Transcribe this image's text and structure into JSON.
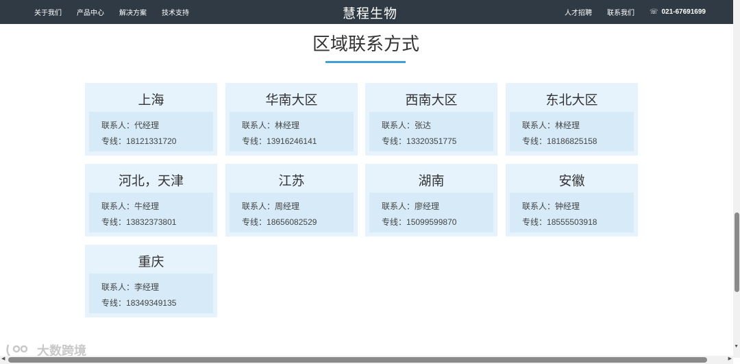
{
  "nav": {
    "left": [
      "关于我们",
      "产品中心",
      "解决方案",
      "技术支持"
    ],
    "brand": "慧程生物",
    "right": [
      "人才招聘",
      "联系我们"
    ],
    "phone_icon": "phone-icon",
    "phone": "021-67691699"
  },
  "section": {
    "title": "区域联系方式",
    "accent": "#3ea0d6"
  },
  "labels": {
    "contact": "联系人：",
    "line": "专线："
  },
  "regions": [
    {
      "name": "上海",
      "contact": "代经理",
      "phone": "18121331720"
    },
    {
      "name": "华南大区",
      "contact": "林经理",
      "phone": "13916246141"
    },
    {
      "name": "西南大区",
      "contact": "张达",
      "phone": "13320351775"
    },
    {
      "name": "东北大区",
      "contact": "林经理",
      "phone": "18186825158"
    },
    {
      "name": "河北，天津",
      "contact": "牛经理",
      "phone": "13832373801"
    },
    {
      "name": "江苏",
      "contact": "周经理",
      "phone": "18656082529"
    },
    {
      "name": "湖南",
      "contact": "廖经理",
      "phone": "15099599870"
    },
    {
      "name": "安徽",
      "contact": "钟经理",
      "phone": "18555503918"
    },
    {
      "name": "重庆",
      "contact": "李经理",
      "phone": "18349349135"
    }
  ],
  "watermark": {
    "text": "大数跨境"
  }
}
